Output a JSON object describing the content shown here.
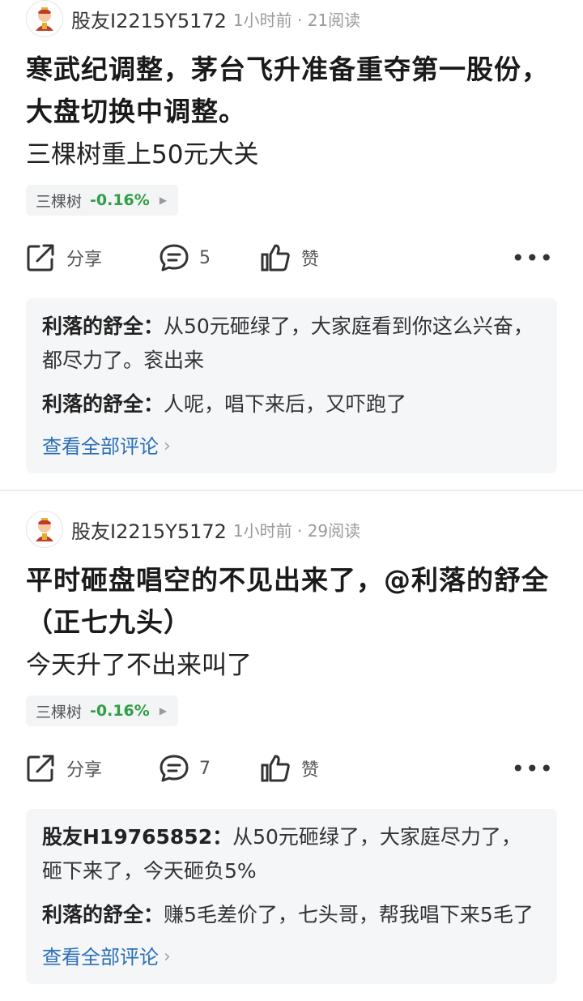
{
  "posts": [
    {
      "username": "股友I2215Y5172",
      "meta": "1小时前 · 21阅读",
      "title": "寒武纪调整，茅台飞升准备重夺第一股份，大盘切换中调整。",
      "subtitle": "三棵树重上50元大关",
      "stock": {
        "name": "三棵树",
        "change": "-0.16%"
      },
      "actions": {
        "share": "分享",
        "comment_count": "5",
        "like": "赞"
      },
      "comments": [
        {
          "author": "利落的舒全：",
          "text": "从50元砸绿了，大家庭看到你这么兴奋，都尽力了。衮出来"
        },
        {
          "author": "利落的舒全：",
          "text": "人呢，唱下来后，又吓跑了"
        }
      ],
      "view_all": "查看全部评论"
    },
    {
      "username": "股友I2215Y5172",
      "meta": "1小时前 · 29阅读",
      "title": "平时砸盘唱空的不见出来了，@利落的舒全（正七九头）",
      "subtitle": "今天升了不出来叫了",
      "stock": {
        "name": "三棵树",
        "change": "-0.16%"
      },
      "actions": {
        "share": "分享",
        "comment_count": "7",
        "like": "赞"
      },
      "comments": [
        {
          "author": "股友H19765852：",
          "text": "从50元砸绿了，大家庭尽力了，砸下来了，今天砸负5%"
        },
        {
          "author": "利落的舒全：",
          "text": "赚5毛差价了，七头哥，帮我唱下来5毛了"
        }
      ],
      "view_all": "查看全部评论"
    }
  ],
  "colors": {
    "stock_change": "#2f9e44",
    "link": "#2a6fb6",
    "comment_bg": "#f5f6f8"
  },
  "icons": [
    "avatar-icon",
    "share-icon",
    "comment-icon",
    "like-icon",
    "more-icon",
    "chevron-right-icon",
    "play-arrow-icon"
  ]
}
